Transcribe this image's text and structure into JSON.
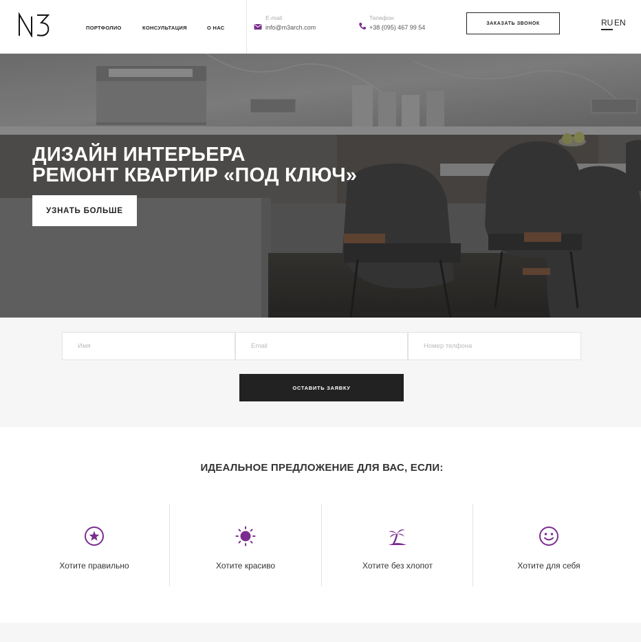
{
  "header": {
    "logo_text": "M3",
    "nav": [
      {
        "label": "ПОРТФОЛИО"
      },
      {
        "label": "КОНСУЛЬТАЦИЯ"
      },
      {
        "label": "О НАС"
      }
    ],
    "email": {
      "label": "E-mail",
      "value": "info@m3arch.com",
      "icon": "envelope-icon"
    },
    "phone": {
      "label": "Телефон",
      "value": "+38 (095) 467 99 54",
      "icon": "phone-icon"
    },
    "callback_button": "ЗАКАЗАТЬ ЗВОНОК",
    "languages": [
      {
        "code": "RU",
        "active": true
      },
      {
        "code": "EN",
        "active": false
      }
    ]
  },
  "hero": {
    "title_line1": "ДИЗАЙН ИНТЕРЬЕРА",
    "title_line2": "РЕМОНТ КВАРТИР «ПОД КЛЮЧ»",
    "button": "УЗНАТЬ БОЛЬШЕ"
  },
  "form": {
    "name_placeholder": "Имя",
    "email_placeholder": "Email",
    "phone_placeholder": "Номер телфона",
    "submit": "ОСТАВИТЬ ЗАЯВКУ"
  },
  "offer": {
    "title": "ИДЕАЛЬНОЕ ПРЕДЛОЖЕНИЕ ДЛЯ ВАС, ЕСЛИ:",
    "features": [
      {
        "label": "Хотите правильно",
        "icon": "star-circle-icon"
      },
      {
        "label": "Хотите красиво",
        "icon": "sun-icon"
      },
      {
        "label": "Хотите без хлопот",
        "icon": "palm-tree-icon"
      },
      {
        "label": "Хотите для себя",
        "icon": "smiley-icon"
      }
    ]
  },
  "colors": {
    "accent": "#7b2d8e",
    "dark": "#222222",
    "light_bg": "#f6f6f6"
  }
}
